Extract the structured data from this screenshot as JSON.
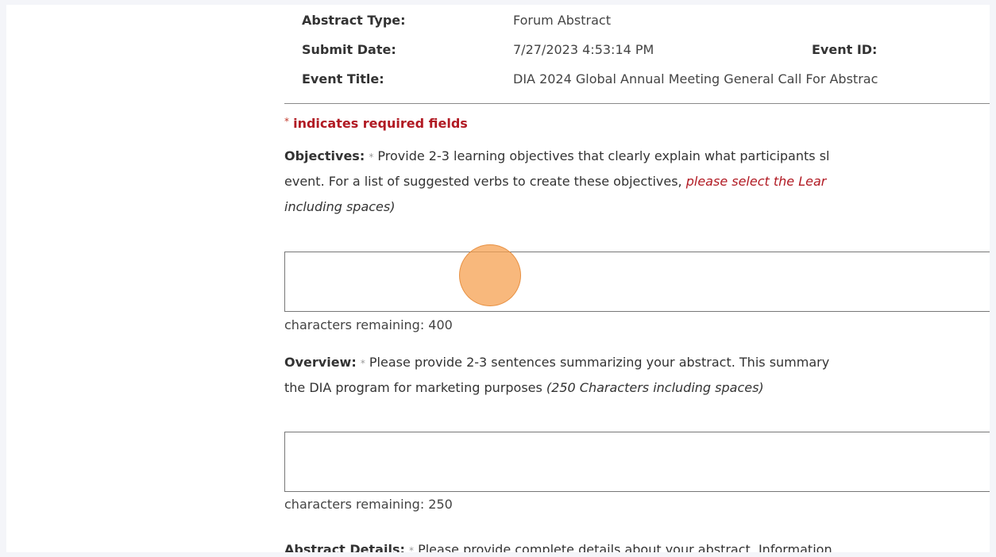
{
  "meta": {
    "abstract_type_label": "Abstract Type:",
    "abstract_type_value": "Forum Abstract",
    "submit_date_label": "Submit Date:",
    "submit_date_value": "7/27/2023 4:53:14 PM",
    "event_id_label": "Event ID:",
    "event_title_label": "Event Title:",
    "event_title_value": "DIA 2024 Global Annual Meeting General Call For Abstrac"
  },
  "required_note": {
    "star": "*",
    "text": "indicates required fields"
  },
  "objectives": {
    "label": "Objectives:",
    "star": "*",
    "line1": "Provide 2-3 learning objectives that clearly explain what participants sl",
    "line2_text": "event. For a list of suggested verbs to create these objectives,",
    "line2_link": "please select the Lear",
    "line3": "including spaces)",
    "counter": "characters remaining: 400"
  },
  "overview": {
    "label": "Overview:",
    "star": "*",
    "line1": "Please provide 2-3 sentences summarizing your abstract. This summary",
    "line2_text": "the DIA program for marketing purposes",
    "line2_italic": "(250 Characters including spaces)",
    "counter": "characters remaining: 250"
  },
  "abstract_details": {
    "label": "Abstract Details:",
    "star": "*",
    "line1": "Please provide complete details about your abstract. Information"
  },
  "colors": {
    "required_red": "#b11a23",
    "click_marker": "#f5a050"
  }
}
